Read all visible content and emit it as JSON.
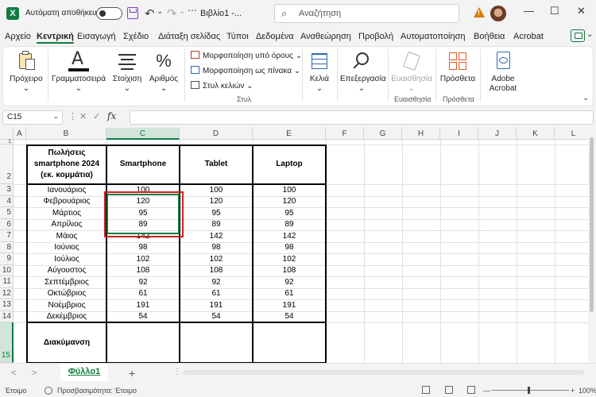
{
  "titlebar": {
    "logo": "X",
    "autosave_label": "Αυτόματη αποθήκευση",
    "doc_title": "Βιβλίο1  -...",
    "search_icon": "⌕",
    "search_placeholder": "Αναζήτηση",
    "undo": "↶",
    "undo_dd": "⌄",
    "redo": "↷",
    "redo_dd": "⌄",
    "more": "⋯",
    "win_min": "—",
    "win_max": "☐",
    "win_close": "✕"
  },
  "menu": {
    "items": [
      "Αρχείο",
      "Κεντρική",
      "Εισαγωγή",
      "Σχέδιο",
      "Διάταξη σελίδας",
      "Τύποι",
      "Δεδομένα",
      "Αναθεώρηση",
      "Προβολή",
      "Αυτοματοποίηση",
      "Βοήθεια",
      "Acrobat"
    ],
    "active_index": 1,
    "more": "⌄"
  },
  "ribbon": {
    "paste": "Πρόχειρο",
    "font": "Γραμματοσειρά",
    "alignment": "Στοίχιση",
    "number": "Αριθμός",
    "conditional": "Μορφοποίηση υπό όρους",
    "as_table": "Μορφοποίηση ως πίνακα",
    "cell_styles": "Στυλ κελιών",
    "styles_group": "Στυλ",
    "cells": "Κελιά",
    "editing": "Επεξεργασία",
    "sensitivity": "Ευαισθησία",
    "sensitivity_group": "Ευαισθησία",
    "addins": "Πρόσθετα",
    "addins_group": "Πρόσθετα",
    "adobe_line1": "Adobe",
    "adobe_line2": "Acrobat",
    "dd": "⌄",
    "font_glyph": "A",
    "number_glyph": "%",
    "collapse": "⌄"
  },
  "formula_bar": {
    "name_box": "C15",
    "name_dd": "⌄",
    "more": "⋮",
    "cancel": "✕",
    "enter": "✓",
    "fx": "fx",
    "value": ""
  },
  "grid": {
    "columns": [
      "A",
      "B",
      "C",
      "D",
      "E",
      "F",
      "G",
      "H",
      "I",
      "J",
      "K",
      "L"
    ],
    "rows": [
      "1",
      "2",
      "3",
      "4",
      "5",
      "6",
      "7",
      "8",
      "9",
      "10",
      "11",
      "12",
      "13",
      "14",
      "15"
    ],
    "selected_column": "C",
    "selected_row": "15"
  },
  "table": {
    "header_product": "Πωλήσεις smartphone 2024 (εκ. κομμάτια)",
    "header_smartphone": "Smartphone",
    "header_tablet": "Tablet",
    "header_laptop": "Laptop",
    "rows": [
      {
        "month": "Ιανουάριος",
        "smartphone": "100",
        "tablet": "100",
        "laptop": "100"
      },
      {
        "month": "Φεβρουάριος",
        "smartphone": "120",
        "tablet": "120",
        "laptop": "120"
      },
      {
        "month": "Μάρτιος",
        "smartphone": "95",
        "tablet": "95",
        "laptop": "95"
      },
      {
        "month": "Απρίλιος",
        "smartphone": "89",
        "tablet": "89",
        "laptop": "89"
      },
      {
        "month": "Μάιος",
        "smartphone": "142",
        "tablet": "142",
        "laptop": "142"
      },
      {
        "month": "Ιούνιος",
        "smartphone": "98",
        "tablet": "98",
        "laptop": "98"
      },
      {
        "month": "Ιούλιος",
        "smartphone": "102",
        "tablet": "102",
        "laptop": "102"
      },
      {
        "month": "Αύγουστος",
        "smartphone": "108",
        "tablet": "108",
        "laptop": "108"
      },
      {
        "month": "Σεπτέμβριος",
        "smartphone": "92",
        "tablet": "92",
        "laptop": "92"
      },
      {
        "month": "Οκτώβριος",
        "smartphone": "61",
        "tablet": "61",
        "laptop": "61"
      },
      {
        "month": "Νοέμβριος",
        "smartphone": "191",
        "tablet": "191",
        "laptop": "191"
      },
      {
        "month": "Δεκέμβριος",
        "smartphone": "54",
        "tablet": "54",
        "laptop": "54"
      }
    ],
    "variance_label": "Διακύμανση"
  },
  "sheets": {
    "tabs": [
      "Φύλλο1"
    ],
    "add": "+",
    "prev": "<",
    "next": ">",
    "more": "⋮"
  },
  "status": {
    "ready": "Έτοιμο",
    "accessibility": "Προσβασιμότητα: Έτοιμο",
    "zoom_minus": "—",
    "zoom_plus": "+",
    "zoom": "100%"
  },
  "colors": {
    "accent": "#107c41",
    "highlight": "#d11f1f"
  }
}
